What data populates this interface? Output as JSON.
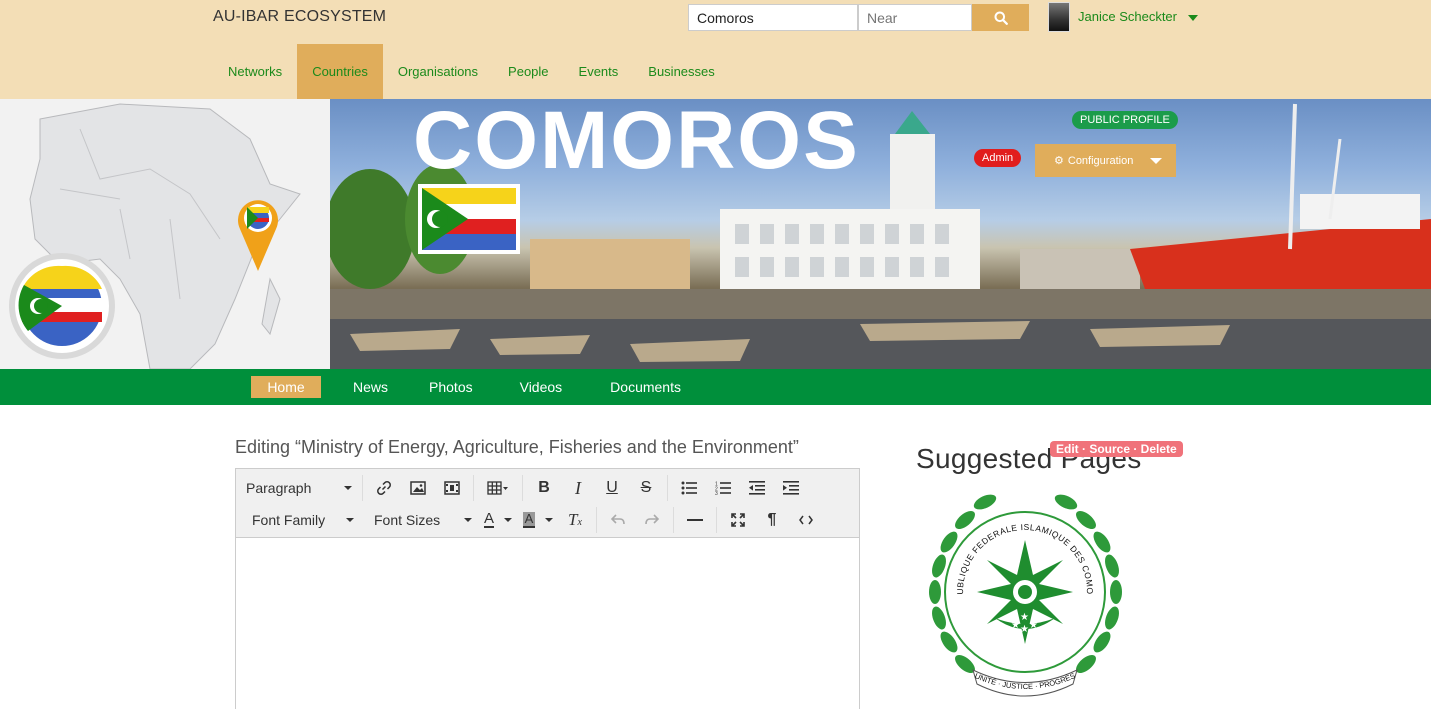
{
  "header": {
    "brand": "AU-IBAR ECOSYSTEM",
    "search_value": "Comoros",
    "near_placeholder": "Near",
    "user_name": "Janice Scheckter",
    "nav": [
      {
        "label": "Networks"
      },
      {
        "label": "Countries",
        "active": true
      },
      {
        "label": "Organisations"
      },
      {
        "label": "People"
      },
      {
        "label": "Events"
      },
      {
        "label": "Businesses"
      }
    ]
  },
  "banner": {
    "title": "COMOROS",
    "public_profile": "PUBLIC PROFILE",
    "admin": "Admin",
    "configuration": "Configuration"
  },
  "subnav": [
    {
      "label": "Home",
      "active": true
    },
    {
      "label": "News"
    },
    {
      "label": "Photos"
    },
    {
      "label": "Videos"
    },
    {
      "label": "Documents"
    }
  ],
  "editor": {
    "title": "Editing “Ministry of Energy, Agriculture, Fisheries and the Environment”",
    "paragraph": "Paragraph",
    "font_family": "Font Family",
    "font_sizes": "Font Sizes"
  },
  "sidebar": {
    "suggested_title": "Suggested Pages",
    "edit_actions": "Edit · Source · Delete",
    "seal_top": "REPUBLIQUE FEDERALE ISLAMIQUE DES COMORES",
    "seal_bottom": "UNITÉ · JUSTICE · PROGRÈS"
  },
  "colors": {
    "header_bg": "#f3deb6",
    "accent": "#e0ad5b",
    "green": "#008f3b",
    "link_green": "#1b8a1b",
    "danger": "#e11d1d"
  }
}
